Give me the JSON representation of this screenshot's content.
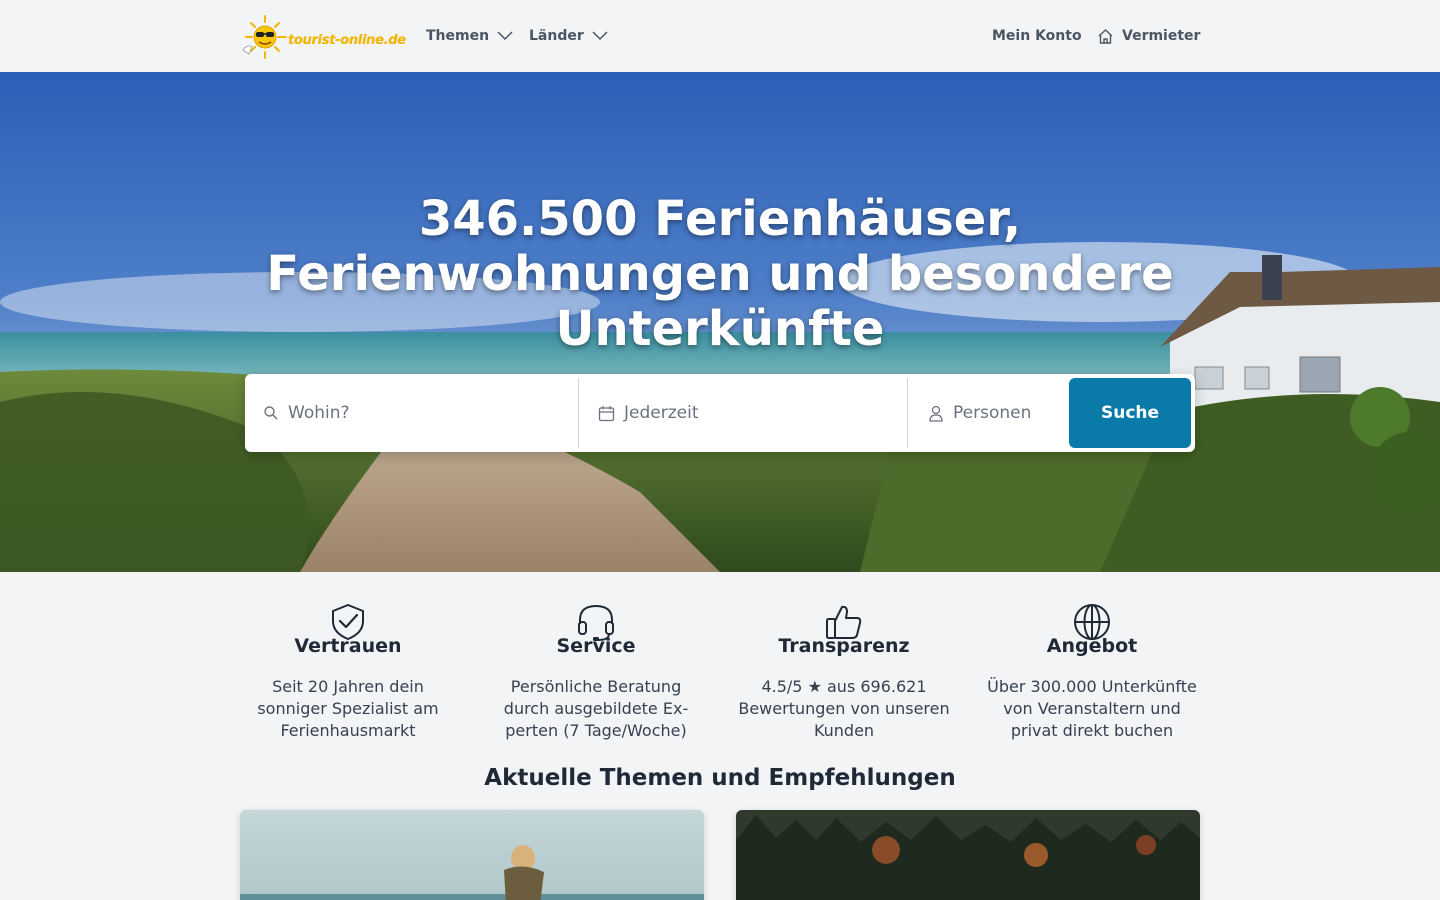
{
  "header": {
    "logo_text": "tourist-online.de",
    "nav": [
      {
        "label": "Themen"
      },
      {
        "label": "Länder"
      }
    ],
    "account_label": "Mein Konto",
    "landlord_label": "Vermieter"
  },
  "hero": {
    "title": "346.500 Ferienhäuser, Ferienwohnungen und besondere Unterkünfte",
    "search": {
      "where_placeholder": "Wohin?",
      "when_placeholder": "Jederzeit",
      "persons_placeholder": "Personen",
      "button_label": "Suche"
    }
  },
  "features": [
    {
      "icon": "shield-check-icon",
      "title": "Vertrauen",
      "desc": "Seit 20 Jahren dein sonniger Spezialist am Ferienhausmarkt"
    },
    {
      "icon": "headset-icon",
      "title": "Service",
      "desc": "Persönliche Beratung durch ausgebildete Ex­perten (7 Tage/Woche)"
    },
    {
      "icon": "thumbs-up-icon",
      "title": "Transparenz",
      "desc": "4.5/5 ★ aus 696.621 Bewertungen von unseren Kunden"
    },
    {
      "icon": "globe-icon",
      "title": "Angebot",
      "desc": "Über 300.000 Unter­künfte von Veranstaltern und privat direkt buchen"
    }
  ],
  "section": {
    "title": "Aktuelle Themen und Empfehlungen"
  },
  "colors": {
    "accent": "#0a7aa8",
    "logo": "#f5b800",
    "background": "#f3f4f6"
  }
}
